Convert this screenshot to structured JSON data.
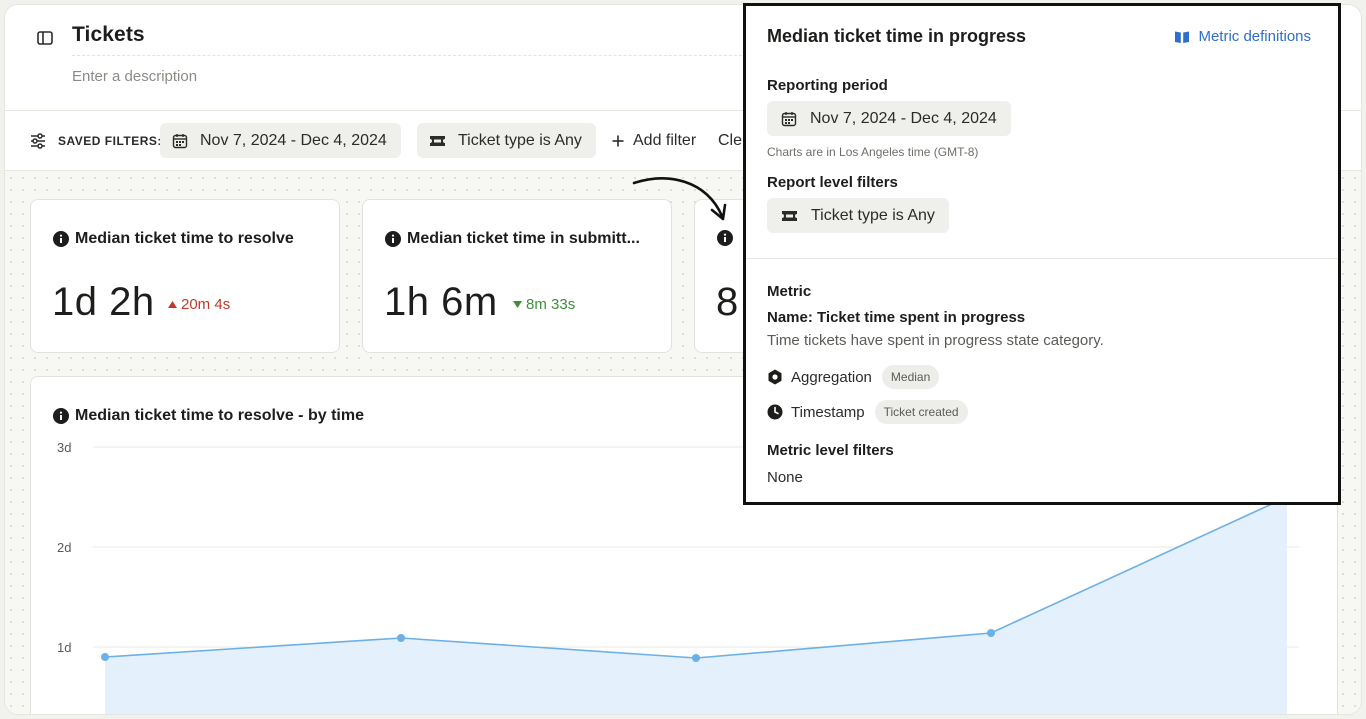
{
  "header": {
    "title": "Tickets",
    "description_placeholder": "Enter a description"
  },
  "filters": {
    "saved_label": "SAVED FILTERS:",
    "date_range": "Nov 7, 2024 - Dec 4, 2024",
    "ticket_type": "Ticket type is Any",
    "add_filter": "Add filter",
    "clear": "Cle"
  },
  "cards": [
    {
      "title": "Median ticket time to resolve",
      "value": "1d 2h",
      "delta": "20m 4s",
      "direction": "up"
    },
    {
      "title": "Median ticket time in submitt...",
      "value": "1h 6m",
      "delta": "8m 33s",
      "direction": "down"
    },
    {
      "title": "",
      "value": "8",
      "delta": "",
      "direction": ""
    }
  ],
  "chart_data": {
    "type": "area",
    "title": "Median ticket time to resolve - by time",
    "xlabel": "",
    "ylabel": "",
    "y_ticks": [
      "1d",
      "2d",
      "3d"
    ],
    "ylim_days": [
      0,
      3
    ],
    "x": [
      1,
      2,
      3,
      4,
      5
    ],
    "series": [
      {
        "values_days": [
          0.9,
          1.09,
          0.89,
          1.14,
          2.5
        ]
      }
    ],
    "grid": true,
    "color": "#6cb0e6"
  },
  "popover": {
    "title": "Median ticket time in progress",
    "link": "Metric definitions",
    "reporting_period_label": "Reporting period",
    "reporting_period": "Nov 7, 2024 - Dec 4, 2024",
    "timezone_note": "Charts are in Los Angeles time (GMT-8)",
    "report_filters_label": "Report level filters",
    "report_filter": "Ticket type is Any",
    "metric_label": "Metric",
    "metric_name": "Name: Ticket time spent in progress",
    "metric_description": "Time tickets have spent in progress state category.",
    "aggregation_label": "Aggregation",
    "aggregation_value": "Median",
    "timestamp_label": "Timestamp",
    "timestamp_value": "Ticket created",
    "metric_filters_label": "Metric level filters",
    "metric_filters_value": "None"
  },
  "colors": {
    "accent_link": "#2f6fc9",
    "delta_up": "#c0392b",
    "delta_down": "#3f8f3a",
    "chart_line": "#6cb0e6",
    "chart_fill": "#e4f0fb"
  }
}
